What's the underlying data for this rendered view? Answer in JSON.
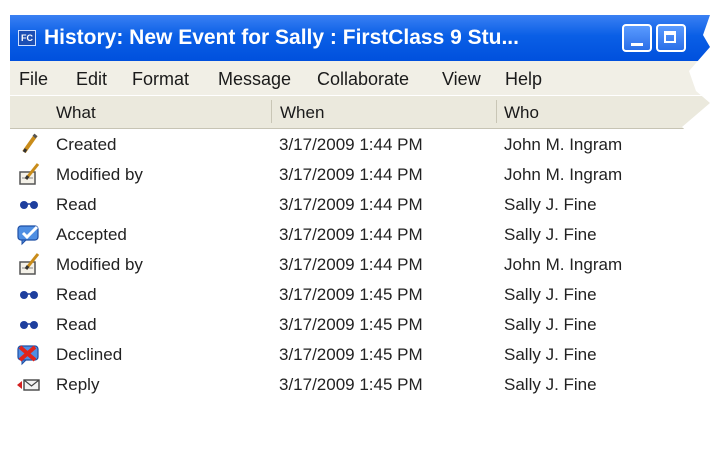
{
  "window": {
    "title": "History: New Event for Sally : FirstClass 9 Stu...",
    "app_icon_glyph": "FC",
    "titlebar_color": "#0a5fe6"
  },
  "menu": [
    "File",
    "Edit",
    "Format",
    "Message",
    "Collaborate",
    "View",
    "Help"
  ],
  "columns": [
    "What",
    "When",
    "Who"
  ],
  "rows": [
    {
      "what": "Created",
      "when": "3/17/2009  1:44 PM",
      "who": "John M. Ingram",
      "icon": "pencil-icon"
    },
    {
      "what": "Modified by",
      "when": "3/17/2009  1:44 PM",
      "who": "John M. Ingram",
      "icon": "edit-document-icon"
    },
    {
      "what": "Read",
      "when": "3/17/2009  1:44 PM",
      "who": "Sally J. Fine",
      "icon": "glasses-icon"
    },
    {
      "what": "Accepted",
      "when": "3/17/2009  1:44 PM",
      "who": "Sally J. Fine",
      "icon": "accepted-check-icon"
    },
    {
      "what": "Modified by",
      "when": "3/17/2009  1:44 PM",
      "who": "John M. Ingram",
      "icon": "edit-document-icon"
    },
    {
      "what": "Read",
      "when": "3/17/2009  1:45 PM",
      "who": "Sally J. Fine",
      "icon": "glasses-icon"
    },
    {
      "what": "Read",
      "when": "3/17/2009  1:45 PM",
      "who": "Sally J. Fine",
      "icon": "glasses-icon"
    },
    {
      "what": "Declined",
      "when": "3/17/2009  1:45 PM",
      "who": "Sally J. Fine",
      "icon": "declined-x-icon"
    },
    {
      "what": "Reply",
      "when": "3/17/2009  1:45 PM",
      "who": "Sally J. Fine",
      "icon": "reply-icon"
    }
  ]
}
